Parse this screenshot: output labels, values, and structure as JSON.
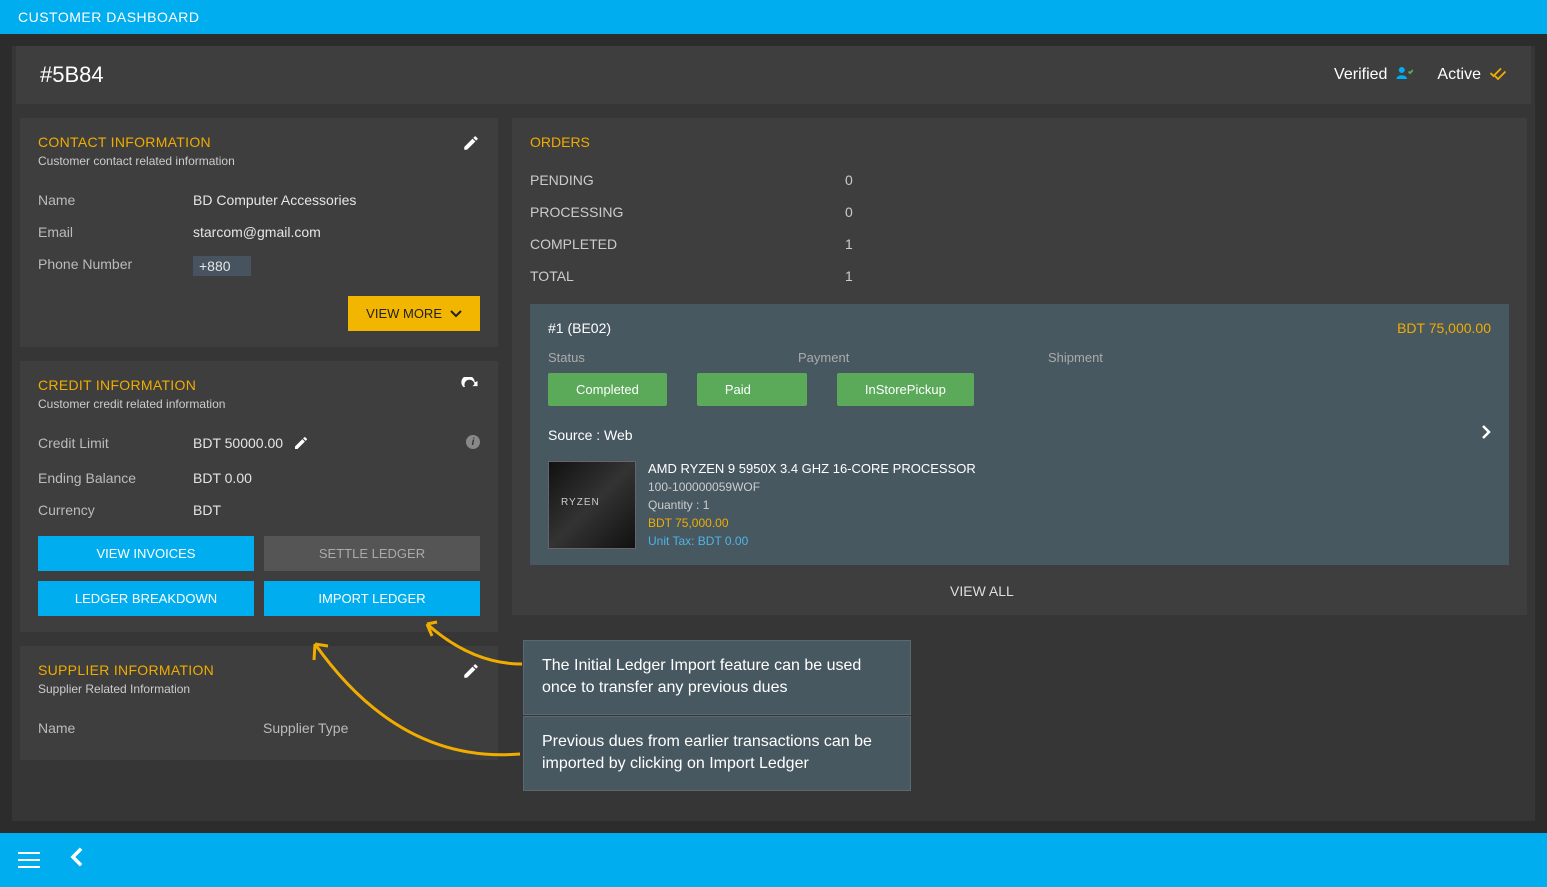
{
  "header": {
    "title": "CUSTOMER DASHBOARD"
  },
  "titleBar": {
    "code": "#5B84",
    "verified": "Verified",
    "active": "Active"
  },
  "contact": {
    "title": "CONTACT INFORMATION",
    "sub": "Customer contact related information",
    "nameLabel": "Name",
    "name": "BD Computer Accessories",
    "emailLabel": "Email",
    "email": "starcom@gmail.com",
    "phoneLabel": "Phone Number",
    "phone": "+880",
    "viewMore": "VIEW MORE"
  },
  "credit": {
    "title": "CREDIT INFORMATION",
    "sub": "Customer credit related information",
    "limitLabel": "Credit Limit",
    "limit": "BDT 50000.00",
    "balanceLabel": "Ending Balance",
    "balance": "BDT 0.00",
    "currencyLabel": "Currency",
    "currency": "BDT",
    "viewInvoices": "VIEW INVOICES",
    "settleLedger": "SETTLE LEDGER",
    "ledgerBreakdown": "LEDGER BREAKDOWN",
    "importLedger": "IMPORT LEDGER"
  },
  "supplier": {
    "title": "SUPPLIER INFORMATION",
    "sub": "Supplier Related Information",
    "nameLabel": "Name",
    "typeLabel": "Supplier Type"
  },
  "orders": {
    "title": "ORDERS",
    "pendingLabel": "PENDING",
    "pending": "0",
    "processingLabel": "PROCESSING",
    "processing": "0",
    "completedLabel": "COMPLETED",
    "completed": "1",
    "totalLabel": "TOTAL",
    "total": "1",
    "item": {
      "id": "#1 (BE02)",
      "price": "BDT 75,000.00",
      "statusLabel": "Status",
      "paymentLabel": "Payment",
      "shipmentLabel": "Shipment",
      "statusBadge": "Completed",
      "paymentBadge": "Paid",
      "shipmentBadge": "InStorePickup",
      "sourceLabel": "Source : Web",
      "product": {
        "name": "AMD RYZEN 9 5950X 3.4 GHZ 16-CORE PROCESSOR",
        "sku": "100-100000059WOF",
        "qty": "Quantity : 1",
        "price": "BDT 75,000.00",
        "tax": "Unit Tax: BDT 0.00"
      }
    },
    "viewAll": "VIEW ALL"
  },
  "annotations": {
    "a1": "The Initial Ledger Import feature can be used once to transfer any previous dues",
    "a2": "Previous dues from earlier transactions can be imported by clicking on Import Ledger"
  }
}
